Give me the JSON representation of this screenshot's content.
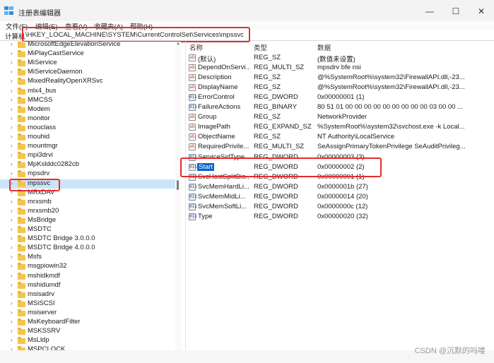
{
  "window": {
    "title": "注册表编辑器",
    "minimize_glyph": "—",
    "maximize_glyph": "☐",
    "close_glyph": "✕"
  },
  "menu": [
    "文件(F)",
    "编辑(E)",
    "查看(V)",
    "收藏夹(A)",
    "帮助(H)"
  ],
  "address": {
    "label": "计算机",
    "path": "\\HKEY_LOCAL_MACHINE\\SYSTEM\\CurrentControlSet\\Services\\mpssvc"
  },
  "tree": {
    "items": [
      "MicrosoftEdgeElevationService",
      "MiPlayCastService",
      "MiService",
      "MiServiceDaemon",
      "MixedRealityOpenXRSvc",
      "mlx4_bus",
      "MMCSS",
      "Modem",
      "monitor",
      "mouclass",
      "mouhid",
      "mountmgr",
      "mpi3drvi",
      "MpKslddc0282cb",
      "mpsdrv",
      "mpssvc",
      "MRxDAV",
      "mrxsmb",
      "mrxsmb20",
      "MsBridge",
      "MSDTC",
      "MSDTC Bridge 3.0.0.0",
      "MSDTC Bridge 4.0.0.0",
      "Msfs",
      "msgpiowin32",
      "mshidkmdf",
      "mshidumdf",
      "msisadrv",
      "MSiSCSI",
      "msiserver",
      "MsKeyboardFilter",
      "MSKSSRV",
      "MsLldp",
      "MSPCLOCK"
    ],
    "selected": "mpssvc"
  },
  "columns": {
    "name": "名称",
    "type": "类型",
    "data": "数据"
  },
  "values": [
    {
      "name": "(默认)",
      "type": "REG_SZ",
      "data": "(数值未设置)",
      "icon": "string-value-icon"
    },
    {
      "name": "DependOnServi...",
      "type": "REG_MULTI_SZ",
      "data": "mpsdrv bfe nsi",
      "icon": "string-value-icon"
    },
    {
      "name": "Description",
      "type": "REG_SZ",
      "data": "@%SystemRoot%\\system32\\FirewallAPI.dll,-23...",
      "icon": "string-value-icon"
    },
    {
      "name": "DisplayName",
      "type": "REG_SZ",
      "data": "@%SystemRoot%\\system32\\FirewallAPI.dll,-23...",
      "icon": "string-value-icon"
    },
    {
      "name": "ErrorControl",
      "type": "REG_DWORD",
      "data": "0x00000001 (1)",
      "icon": "binary-value-icon"
    },
    {
      "name": "FailureActions",
      "type": "REG_BINARY",
      "data": "80 51 01 00 00 00 00 00 00 00 00 00 03 00 00 ...",
      "icon": "binary-value-icon"
    },
    {
      "name": "Group",
      "type": "REG_SZ",
      "data": "NetworkProvider",
      "icon": "string-value-icon"
    },
    {
      "name": "ImagePath",
      "type": "REG_EXPAND_SZ",
      "data": "%SystemRoot%\\system32\\svchost.exe -k Local...",
      "icon": "string-value-icon"
    },
    {
      "name": "ObjectName",
      "type": "REG_SZ",
      "data": "NT Authority\\LocalService",
      "icon": "string-value-icon"
    },
    {
      "name": "RequiredPrivile...",
      "type": "REG_MULTI_SZ",
      "data": "SeAssignPrimaryTokenPrivilege SeAuditPrivileg...",
      "icon": "string-value-icon"
    },
    {
      "name": "ServiceSidType",
      "type": "REG_DWORD",
      "data": "0x00000003 (3)",
      "icon": "binary-value-icon"
    },
    {
      "name": "Start",
      "type": "REG_DWORD",
      "data": "0x00000002 (2)",
      "icon": "binary-value-icon"
    },
    {
      "name": "SvcHostSplitDis...",
      "type": "REG_DWORD",
      "data": "0x00000001 (1)",
      "icon": "binary-value-icon"
    },
    {
      "name": "SvcMemHardLi...",
      "type": "REG_DWORD",
      "data": "0x0000001b (27)",
      "icon": "binary-value-icon"
    },
    {
      "name": "SvcMemMidLi...",
      "type": "REG_DWORD",
      "data": "0x00000014 (20)",
      "icon": "binary-value-icon"
    },
    {
      "name": "SvcMemSoftLi...",
      "type": "REG_DWORD",
      "data": "0x0000000c (12)",
      "icon": "binary-value-icon"
    },
    {
      "name": "Type",
      "type": "REG_DWORD",
      "data": "0x00000020 (32)",
      "icon": "binary-value-icon"
    }
  ],
  "selected_value": "Start",
  "watermark": "CSDN @沉默的吗喽",
  "colors": {
    "highlight_box": "#e52d2d",
    "selection": "#0a64c8",
    "folder": "#f3c54c"
  }
}
